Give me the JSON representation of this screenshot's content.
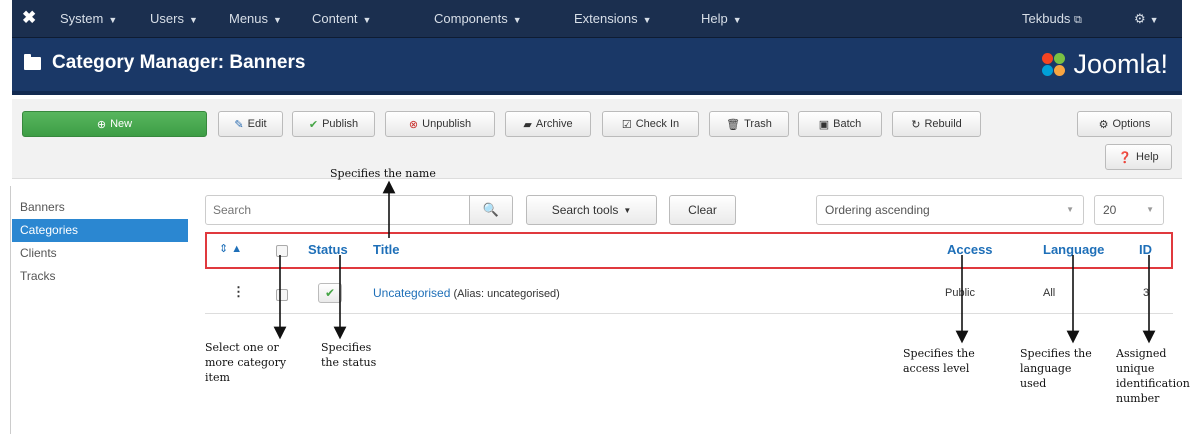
{
  "navbar": {
    "menus": [
      "System",
      "Users",
      "Menus",
      "Content",
      "Components",
      "Extensions",
      "Help"
    ],
    "user": "Tekbuds",
    "settings_icon": "gear-icon"
  },
  "titlebar": {
    "title": "Category Manager: Banners",
    "brand": "Joomla!",
    "brand_colors": [
      "#f44321",
      "#7ac143",
      "#f9a541",
      "#00a0d8"
    ]
  },
  "toolbar": {
    "new": "New",
    "edit": "Edit",
    "publish": "Publish",
    "unpublish": "Unpublish",
    "archive": "Archive",
    "checkin": "Check In",
    "trash": "Trash",
    "batch": "Batch",
    "rebuild": "Rebuild",
    "options": "Options",
    "help": "Help"
  },
  "sidebar": {
    "items": [
      "Banners",
      "Categories",
      "Clients",
      "Tracks"
    ],
    "active": "Categories"
  },
  "filters": {
    "search_placeholder": "Search",
    "search_tools": "Search tools",
    "clear": "Clear",
    "ordering": "Ordering ascending",
    "limit": "20"
  },
  "table": {
    "columns": {
      "status": "Status",
      "title": "Title",
      "access": "Access",
      "language": "Language",
      "id": "ID"
    },
    "rows": [
      {
        "title": "Uncategorised",
        "alias": "(Alias: uncategorised)",
        "access": "Public",
        "language": "All",
        "id": "3"
      }
    ]
  },
  "annotations": {
    "name": "Specifies the name",
    "select": [
      "Select one or",
      "more category",
      "item"
    ],
    "status": [
      "Specifies",
      "the status"
    ],
    "access": [
      "Specifies the",
      "access level"
    ],
    "language": [
      "Specifies the",
      "language",
      "used"
    ],
    "id": [
      "Assigned",
      "unique",
      "identification",
      "number"
    ]
  }
}
